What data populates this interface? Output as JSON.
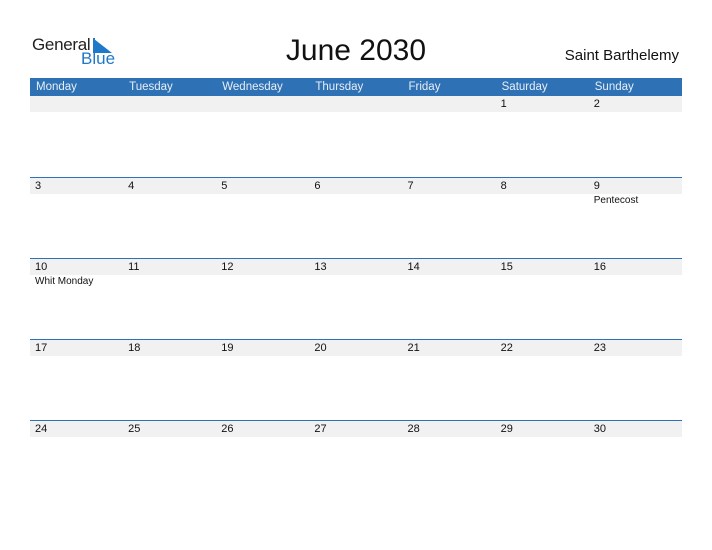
{
  "logo": {
    "general": "General",
    "blue": "Blue"
  },
  "title": "June 2030",
  "country": "Saint Barthelemy",
  "weekdays": [
    "Monday",
    "Tuesday",
    "Wednesday",
    "Thursday",
    "Friday",
    "Saturday",
    "Sunday"
  ],
  "weeks": [
    {
      "days": [
        "",
        "",
        "",
        "",
        "",
        "1",
        "2"
      ],
      "holidays": [
        "",
        "",
        "",
        "",
        "",
        "",
        ""
      ]
    },
    {
      "days": [
        "3",
        "4",
        "5",
        "6",
        "7",
        "8",
        "9"
      ],
      "holidays": [
        "",
        "",
        "",
        "",
        "",
        "",
        "Pentecost"
      ]
    },
    {
      "days": [
        "10",
        "11",
        "12",
        "13",
        "14",
        "15",
        "16"
      ],
      "holidays": [
        "Whit Monday",
        "",
        "",
        "",
        "",
        "",
        ""
      ]
    },
    {
      "days": [
        "17",
        "18",
        "19",
        "20",
        "21",
        "22",
        "23"
      ],
      "holidays": [
        "",
        "",
        "",
        "",
        "",
        "",
        ""
      ]
    },
    {
      "days": [
        "24",
        "25",
        "26",
        "27",
        "28",
        "29",
        "30"
      ],
      "holidays": [
        "",
        "",
        "",
        "",
        "",
        "",
        ""
      ]
    }
  ]
}
